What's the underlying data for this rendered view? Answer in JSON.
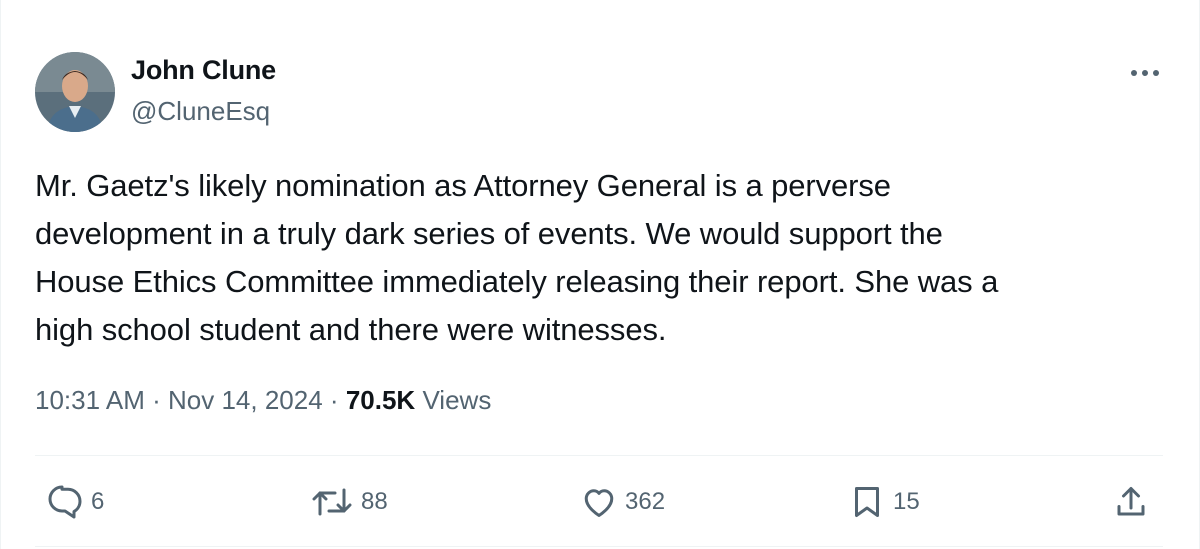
{
  "author": {
    "display_name": "John Clune",
    "handle": "@CluneEsq"
  },
  "tweet": {
    "text": "Mr. Gaetz's likely nomination as Attorney General is a perverse\ndevelopment in a truly dark series of events. We would support the\nHouse Ethics Committee immediately releasing their report. She was a\nhigh school student and there were witnesses.",
    "time": "10:31 AM",
    "separator": "·",
    "date": "Nov 14, 2024",
    "views_count": "70.5K",
    "views_label": "Views"
  },
  "actions": {
    "replies": "6",
    "reposts": "88",
    "likes": "362",
    "bookmarks": "15"
  },
  "icons": {
    "more": "more-dots-icon",
    "reply": "reply-bubble-icon",
    "repost": "repost-arrows-icon",
    "like": "heart-icon",
    "bookmark": "bookmark-icon",
    "share": "share-upload-icon"
  },
  "colors": {
    "text_primary": "#0f1419",
    "text_secondary": "#536471",
    "divider": "#eff3f4"
  }
}
